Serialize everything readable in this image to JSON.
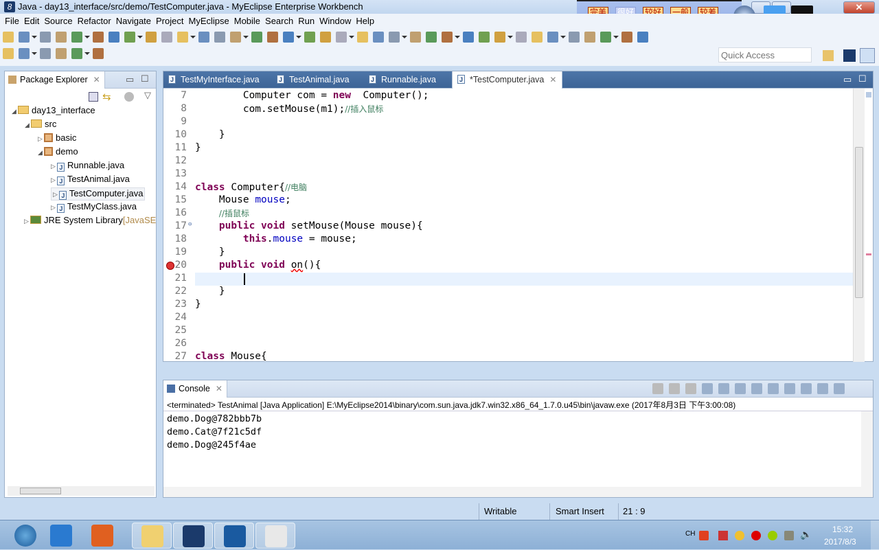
{
  "window": {
    "title": "Java - day13_interface/src/demo/TestComputer.java - MyEclipse Enterprise Workbench",
    "app_icon_glyph": "8"
  },
  "overlay_toolbar": {
    "quality_buttons": [
      [
        "完美",
        "画质"
      ],
      [
        "很好",
        "画质"
      ],
      [
        "较好",
        "画质"
      ],
      [
        "一般",
        "画质"
      ],
      [
        "较差",
        "画质"
      ]
    ]
  },
  "menu": [
    "File",
    "Edit",
    "Source",
    "Refactor",
    "Navigate",
    "Project",
    "MyEclipse",
    "Mobile",
    "Search",
    "Run",
    "Window",
    "Help"
  ],
  "toolbar1_icons": [
    "new-icon",
    "new-class-icon",
    "save-icon",
    "save-all-icon",
    "print-icon",
    "new-web-project-icon",
    "mobile-run-icon",
    "mobile-debug-icon",
    "build-icon",
    "web-service-icon",
    "deploy-icon",
    "server-icon",
    "run-server-icon",
    "run-app-icon",
    "browser-icon",
    "db-icon",
    "db-connect-icon",
    "report-icon",
    "gear-icon",
    "camera-icon",
    "debug-icon",
    "run-icon",
    "run-ext-icon",
    "coverage-icon",
    "refresh-icon",
    "open-folder-icon",
    "pen-icon",
    "open-project-icon",
    "open-type-icon",
    "history-icon",
    "highlight-icon",
    "occurrence-icon",
    "block-icon",
    "whitespace-icon",
    "back-icon",
    "forward-icon",
    "pin-icon"
  ],
  "toolbar2_icons": [
    "next-annotation-icon",
    "prev-annotation-icon",
    "last-edit-icon",
    "back-icon",
    "forward-icon",
    "maximize-view-icon"
  ],
  "quick_access": {
    "placeholder": "Quick Access"
  },
  "package_explorer": {
    "tab": "Package Explorer",
    "tree": [
      {
        "label": "day13_interface",
        "type": "project",
        "depth": 0,
        "expanded": true
      },
      {
        "label": "src",
        "type": "folder",
        "depth": 1,
        "expanded": true
      },
      {
        "label": "basic",
        "type": "package",
        "depth": 2,
        "expanded": false
      },
      {
        "label": "demo",
        "type": "package",
        "depth": 2,
        "expanded": true
      },
      {
        "label": "Runnable.java",
        "type": "java",
        "depth": 3
      },
      {
        "label": "TestAnimal.java",
        "type": "java",
        "depth": 3
      },
      {
        "label": "TestComputer.java",
        "type": "java",
        "depth": 3,
        "selected": true
      },
      {
        "label": "TestMyClass.java",
        "type": "java",
        "depth": 3
      },
      {
        "label": "JRE System Library",
        "suffix": "[JavaSE",
        "type": "library",
        "depth": 1,
        "expanded": false
      }
    ]
  },
  "editor": {
    "tabs": [
      {
        "label": "TestMyInterface.java"
      },
      {
        "label": "TestAnimal.java"
      },
      {
        "label": "Runnable.java"
      },
      {
        "label": "*TestComputer.java",
        "active": true
      }
    ],
    "current_line": 21,
    "error_line": 20,
    "lines": [
      {
        "n": "7",
        "seg": [
          [
            "",
            "        Computer com = "
          ],
          [
            "kw",
            "new"
          ],
          [
            "",
            "  Computer();"
          ]
        ]
      },
      {
        "n": "8",
        "seg": [
          [
            "",
            "        com.setMouse(m1);"
          ],
          [
            "cm",
            "//插入鼠标"
          ]
        ]
      },
      {
        "n": "9",
        "seg": []
      },
      {
        "n": "10",
        "seg": [
          [
            "",
            "    }"
          ]
        ]
      },
      {
        "n": "11",
        "seg": [
          [
            "",
            "}"
          ]
        ]
      },
      {
        "n": "12",
        "seg": []
      },
      {
        "n": "13",
        "seg": []
      },
      {
        "n": "14",
        "seg": [
          [
            "kw",
            "class"
          ],
          [
            "",
            " Computer{"
          ],
          [
            "cm",
            "//电脑"
          ]
        ]
      },
      {
        "n": "15",
        "seg": [
          [
            "",
            "    Mouse "
          ],
          [
            "fld",
            "mouse"
          ],
          [
            "",
            ";"
          ]
        ]
      },
      {
        "n": "16",
        "seg": [
          [
            "",
            "    "
          ],
          [
            "cm",
            "//插鼠标"
          ]
        ]
      },
      {
        "n": "17",
        "seg": [
          [
            "",
            "    "
          ],
          [
            "kw",
            "public void"
          ],
          [
            "",
            " setMouse(Mouse mouse){"
          ]
        ]
      },
      {
        "n": "18",
        "seg": [
          [
            "",
            "        "
          ],
          [
            "kw",
            "this"
          ],
          [
            "",
            "."
          ],
          [
            "fld",
            "mouse"
          ],
          [
            "",
            " = mouse;"
          ]
        ]
      },
      {
        "n": "19",
        "seg": [
          [
            "",
            "    }"
          ]
        ]
      },
      {
        "n": "20",
        "seg": [
          [
            "",
            "    "
          ],
          [
            "kw",
            "public void"
          ],
          [
            "",
            " "
          ],
          [
            "err",
            "on"
          ],
          [
            "",
            "(){"
          ]
        ]
      },
      {
        "n": "21",
        "seg": []
      },
      {
        "n": "22",
        "seg": [
          [
            "",
            "    }"
          ]
        ]
      },
      {
        "n": "23",
        "seg": [
          [
            "",
            "}"
          ]
        ]
      },
      {
        "n": "24",
        "seg": []
      },
      {
        "n": "25",
        "seg": []
      },
      {
        "n": "26",
        "seg": []
      },
      {
        "n": "27",
        "seg": [
          [
            "kw",
            "class"
          ],
          [
            "",
            " Mouse{"
          ]
        ]
      }
    ]
  },
  "console": {
    "tab": "Console",
    "header": "<terminated> TestAnimal [Java Application] E:\\MyEclipse2014\\binary\\com.sun.java.jdk7.win32.x86_64_1.7.0.u45\\bin\\javaw.exe (2017年8月3日 下午3:00:08)",
    "output": [
      "demo.Dog@782bbb7b",
      "demo.Cat@7f21c5df",
      "demo.Dog@245f4ae"
    ]
  },
  "status": {
    "writable": "Writable",
    "insert_mode": "Smart Insert",
    "position": "21 : 9"
  },
  "taskbar": {
    "apps": [
      "start-button",
      "internet-explorer",
      "pdf-reader",
      "file-explorer",
      "myeclipse",
      "mp-player",
      "app-red-green"
    ],
    "tray_lang": "CH",
    "time": "15:32",
    "date": "2017/8/3"
  },
  "colors": {
    "keyword": "#7f0055",
    "comment": "#3f7f5f",
    "field": "#0000c0",
    "editor_tab_bar": "#4d75a8"
  }
}
